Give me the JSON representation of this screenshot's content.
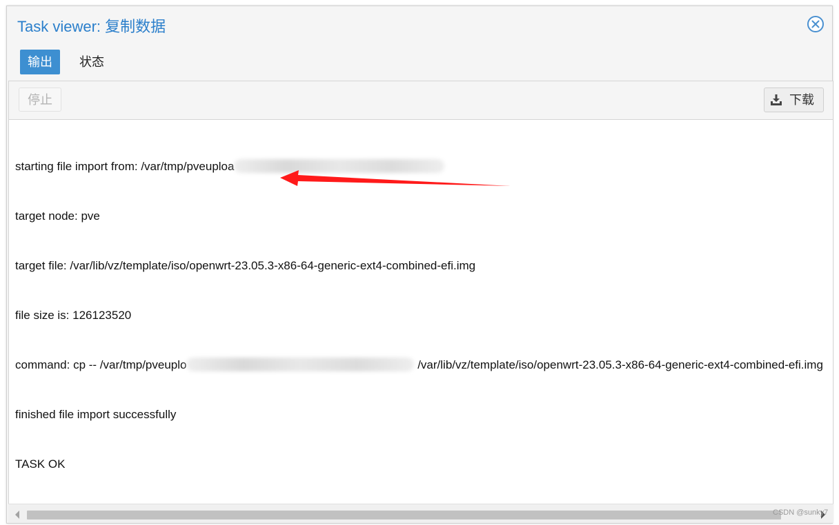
{
  "window": {
    "title_prefix": "Task viewer: ",
    "title_task": "复制数据"
  },
  "tabs": [
    {
      "label": "输出",
      "active": true
    },
    {
      "label": "状态",
      "active": false
    }
  ],
  "toolbar": {
    "stop_label": "停止",
    "download_label": "下载"
  },
  "log": {
    "line1_prefix": "starting file import from: /var/tmp/pveuploa",
    "line2": "target node: pve",
    "line3": "target file: /var/lib/vz/template/iso/openwrt-23.05.3-x86-64-generic-ext4-combined-efi.img",
    "line4": "file size is: 126123520",
    "line5_prefix": "command: cp -- /var/tmp/pveuplo",
    "line5_suffix": " /var/lib/vz/template/iso/openwrt-23.05.3-x86-64-generic-ext4-combined-efi.img",
    "line6": "finished file import successfully",
    "line7": "TASK OK"
  },
  "annotation": {
    "arrow_color": "#ff1a1a"
  },
  "watermark": "CSDN @sunky7",
  "colors": {
    "accent": "#3d8fd1",
    "title": "#2b7fcb"
  }
}
